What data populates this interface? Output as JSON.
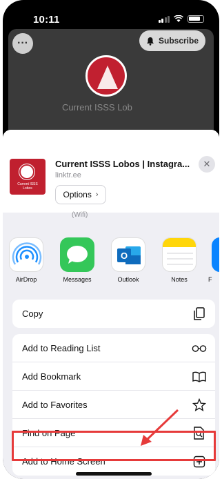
{
  "status_bar": {
    "time": "10:11"
  },
  "background_page": {
    "subscribe_label": "Subscribe",
    "title_partial": "Current ISSS Lob"
  },
  "share_sheet": {
    "title": "Current ISSS Lobos | Instagra...",
    "domain": "linktr.ee",
    "options_label": "Options",
    "wifi_text": "(Wifi)",
    "thumbnail_text": "Current ISSS Lobos"
  },
  "apps": [
    {
      "label": "AirDrop",
      "icon": "airdrop-icon",
      "color": "#1e90ff"
    },
    {
      "label": "Messages",
      "icon": "messages-icon",
      "color": "#34c759"
    },
    {
      "label": "Outlook",
      "icon": "outlook-icon",
      "color": "#0f6cbd"
    },
    {
      "label": "Notes",
      "icon": "notes-icon",
      "color": "#ffd60a"
    },
    {
      "label": "F",
      "icon": "app-icon",
      "color": "#0a84ff"
    }
  ],
  "actions": {
    "copy": {
      "label": "Copy",
      "icon": "copy-icon"
    },
    "reading_list": {
      "label": "Add to Reading List",
      "icon": "glasses-icon"
    },
    "bookmark": {
      "label": "Add Bookmark",
      "icon": "book-icon"
    },
    "favorites": {
      "label": "Add to Favorites",
      "icon": "star-icon"
    },
    "find": {
      "label": "Find on Page",
      "icon": "find-document-icon"
    },
    "home_screen": {
      "label": "Add to Home Screen",
      "icon": "plus-square-icon"
    }
  },
  "colors": {
    "highlight": "#e63a3a",
    "sheet_bg": "#efeff4"
  }
}
